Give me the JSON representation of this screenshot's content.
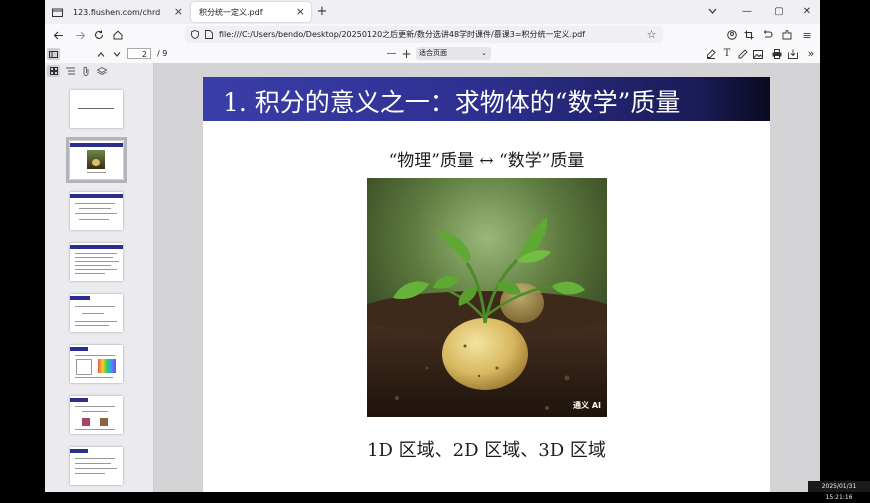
{
  "tabs": [
    {
      "title": "123.fiushen.com/chrd",
      "active": false
    },
    {
      "title": "积分统一定义.pdf",
      "active": true
    }
  ],
  "new_tab_symbol": "+",
  "window_controls": {
    "minimize": "—",
    "maximize": "▢",
    "close": "✕"
  },
  "url": "file:///C:/Users/bendo/Desktop/20250120之后更新/数分选讲48学时课件/慕课3=积分统一定义.pdf",
  "pdf_toolbar": {
    "page_current": "2",
    "page_total": "/ 9",
    "zoom_minus": "—",
    "zoom_plus": "+",
    "zoom_label": "适合页面"
  },
  "slide": {
    "title": "1. 积分的意义之一：求物体的“数学”质量",
    "subtitle": "“物理”质量  ↔  “数学”质量",
    "bottom": "1D 区域、2D 区域、3D 区域",
    "watermark": "通义 AI"
  },
  "taskbar_clock": "2025/01/31 15:21:16",
  "colors": {
    "banner": "#2d2f8f",
    "chrome": "#f0f0f4",
    "canvas": "#d4d4d7"
  }
}
